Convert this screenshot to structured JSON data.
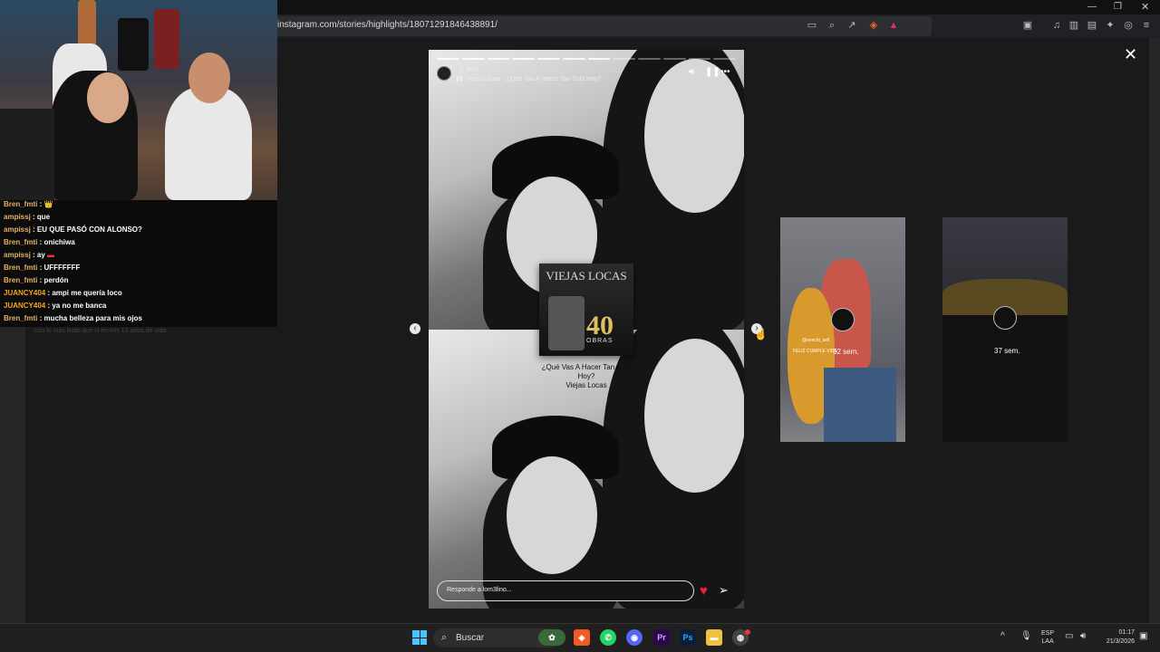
{
  "browser": {
    "url": "instagram.com/stories/highlights/18071291846438891/"
  },
  "chat": {
    "messages": [
      {
        "user": "Bren_fmti",
        "text": "👑"
      },
      {
        "user": "ampissj",
        "text": "que"
      },
      {
        "user": "ampissj",
        "text": "EU QUE PASÓ CON ALONSO?"
      },
      {
        "user": "Bren_fmti",
        "text": "onichiwa"
      },
      {
        "user": "ampissj",
        "text": "ay"
      },
      {
        "user": "Bren_fmti",
        "text": "UFFFFFFF"
      },
      {
        "user": "Bren_fmti",
        "text": "perdón"
      },
      {
        "user": "JUANCY404",
        "text": "ampi me quería loco"
      },
      {
        "user": "JUANCY404",
        "text": "ya no me banca"
      },
      {
        "user": "Bren_fmti",
        "text": "mucha belleza para mis ojos"
      }
    ],
    "ghost_text": "con lo más lindo que vi en mis 13 años de vida"
  },
  "story": {
    "time": "5 sem",
    "music_line": "Viejas Locas · ¿Qué Vas A Hacer Tan Sola Hoy?",
    "album_title": "VIEJAS LOCAS",
    "album_number": "40",
    "album_sub": "OBRAS",
    "song_title": "¿Qué Vas A Hacer Tan Sola Hoy?",
    "song_artist": "Viejas Locas",
    "reply_placeholder": "Responde a lom3lino...",
    "progress_segments": 12,
    "progress_watched": 7
  },
  "thumbnails": [
    {
      "user": "@eenchi_sell",
      "caption": "FELIZ CUMPLE VIDA",
      "time": "52 sem."
    },
    {
      "time": "37 sem."
    }
  ],
  "taskbar": {
    "search_label": "Buscar",
    "lang_top": "ESP",
    "lang_bottom": "LAA",
    "time": "01:17",
    "date": "21/3/2026"
  }
}
